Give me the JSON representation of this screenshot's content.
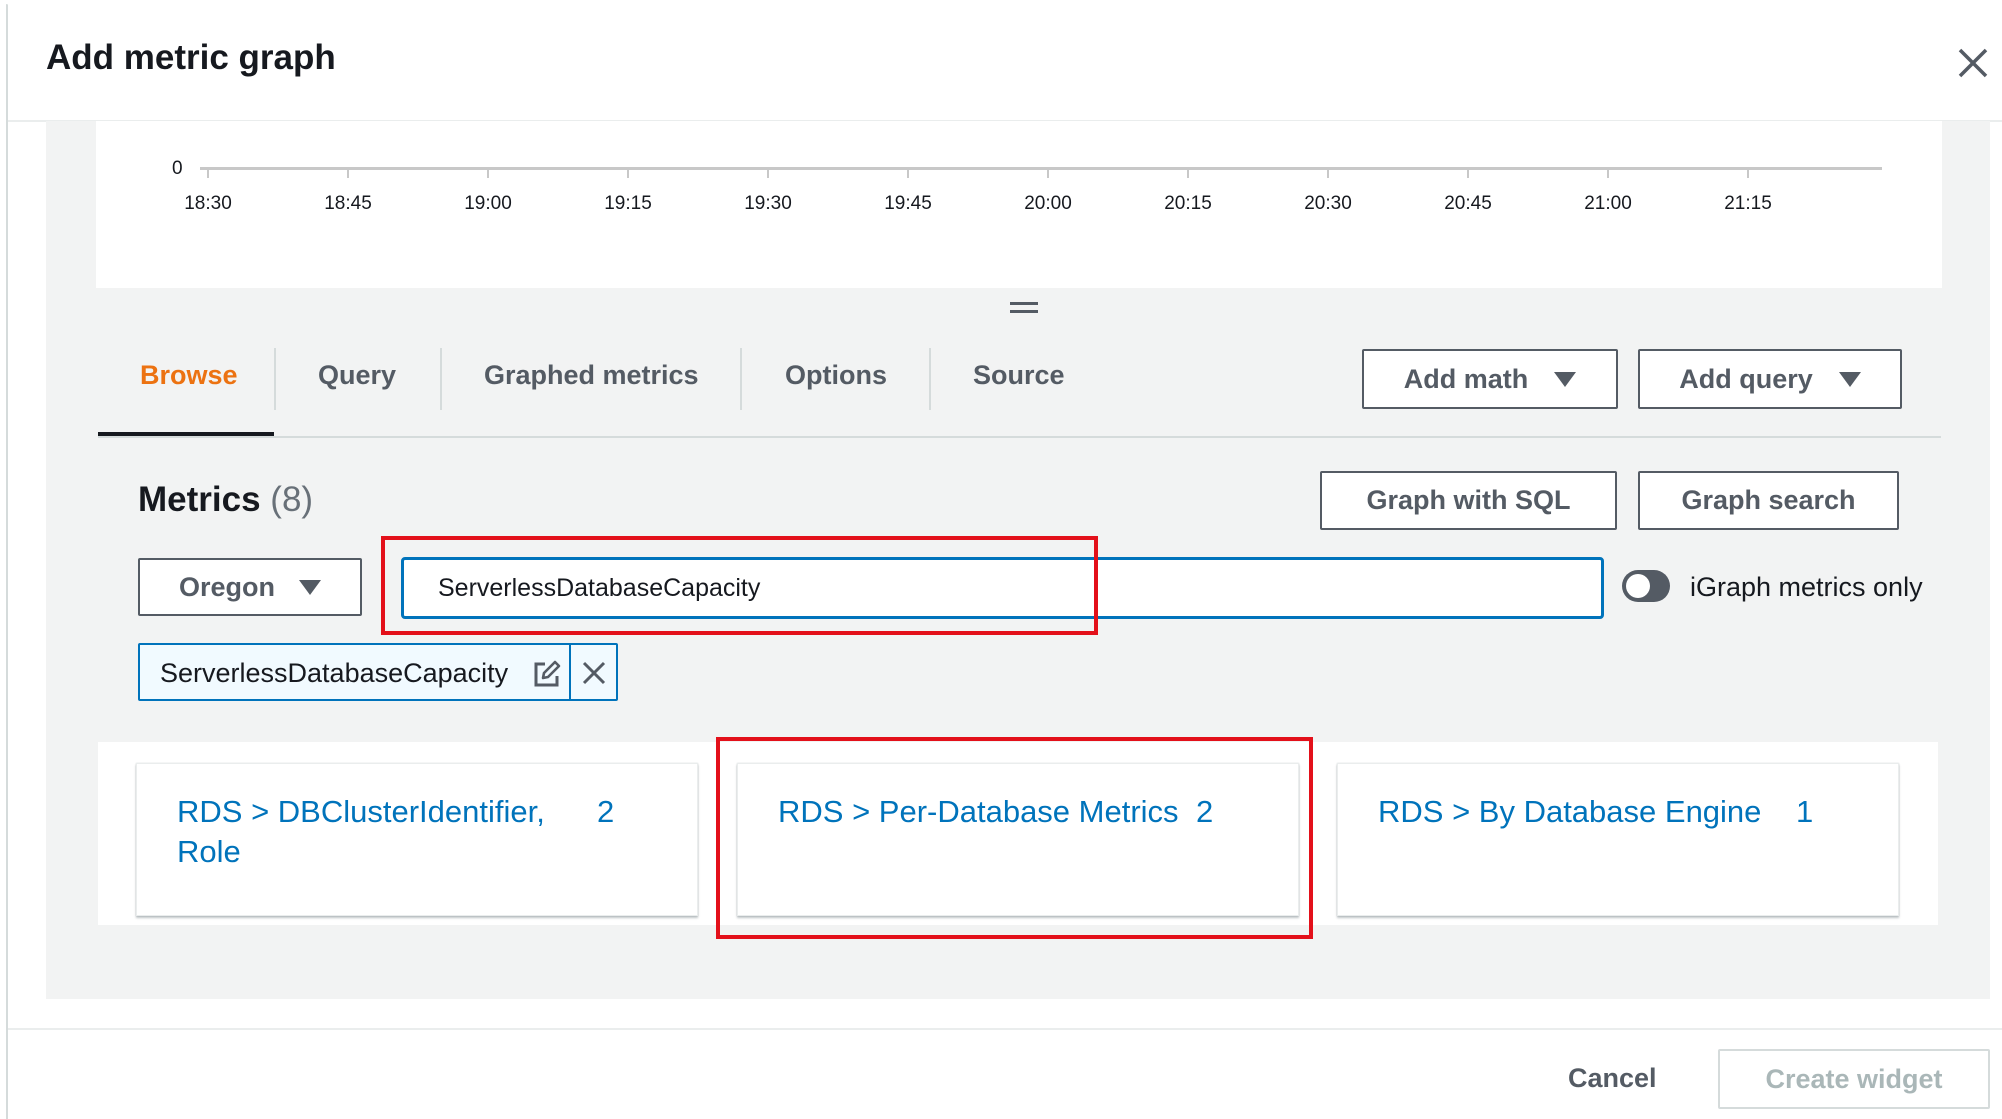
{
  "modal": {
    "title": "Add metric graph",
    "close_icon": "close-icon"
  },
  "graph": {
    "y_axis_label": "0",
    "x_ticks": [
      "18:30",
      "18:45",
      "19:00",
      "19:15",
      "19:30",
      "19:45",
      "20:00",
      "20:15",
      "20:30",
      "20:45",
      "21:00",
      "21:15"
    ]
  },
  "tabs": {
    "items": [
      {
        "label": "Browse",
        "active": true
      },
      {
        "label": "Query",
        "active": false
      },
      {
        "label": "Graphed metrics",
        "active": false
      },
      {
        "label": "Options",
        "active": false
      },
      {
        "label": "Source",
        "active": false
      }
    ],
    "add_math": "Add math",
    "add_query": "Add query"
  },
  "metrics": {
    "title": "Metrics",
    "count": "(8)",
    "graph_with_sql": "Graph with SQL",
    "graph_search": "Graph search",
    "region": "Oregon",
    "search_value": "ServerlessDatabaseCapacity",
    "toggle_label": "iGraph metrics only",
    "toggle_on": false,
    "token": "ServerlessDatabaseCapacity"
  },
  "namespaces": [
    {
      "name_line1": "RDS > DBClusterIdentifier,",
      "name_line2": "Role",
      "count": "2"
    },
    {
      "name_line1": "RDS > Per-Database Metrics",
      "name_line2": "",
      "count": "2"
    },
    {
      "name_line1": "RDS > By Database Engine",
      "name_line2": "",
      "count": "1"
    }
  ],
  "footer": {
    "cancel": "Cancel",
    "create_widget": "Create widget"
  },
  "colors": {
    "accent_orange": "#ec7211",
    "link_blue": "#0073bb",
    "highlight_red": "#e3101a"
  }
}
